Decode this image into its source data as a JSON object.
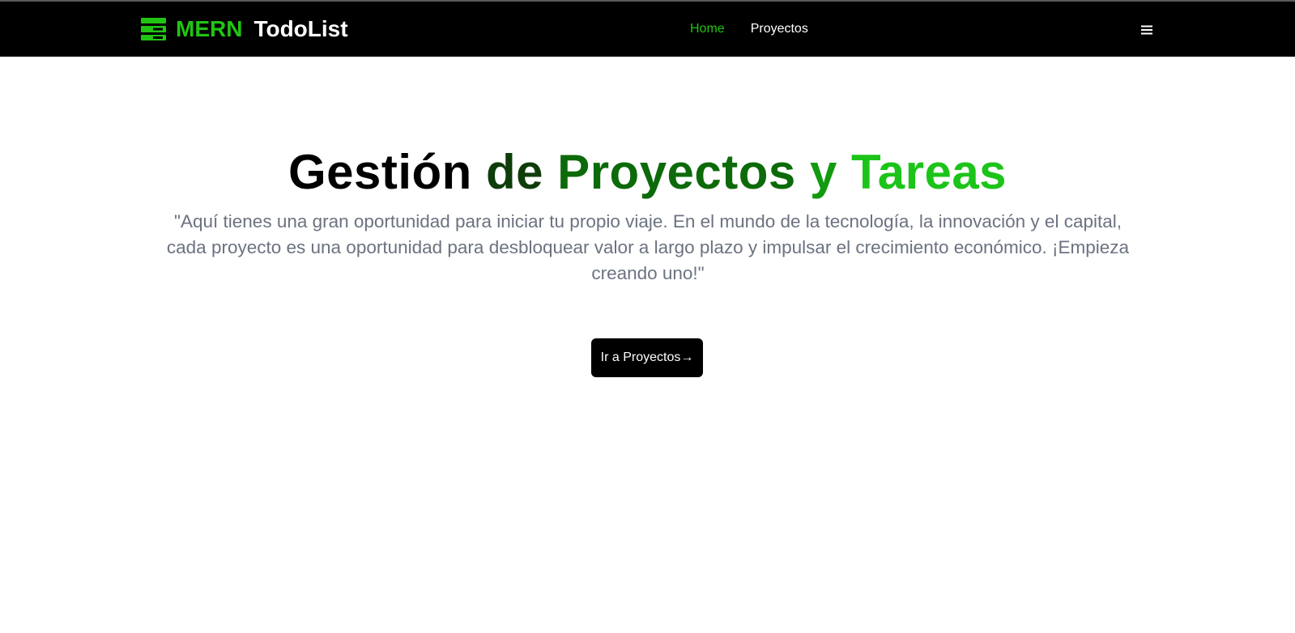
{
  "brand": {
    "prefix": "MERN",
    "name": "TodoList",
    "icon": "server-stack-icon",
    "accent_color": "#22c414"
  },
  "nav": {
    "items": [
      {
        "label": "Home",
        "active": true
      },
      {
        "label": "Proyectos",
        "active": false
      }
    ],
    "menu_icon": "hamburger-menu-icon"
  },
  "hero": {
    "title_parts": [
      "Gestión",
      "de",
      "Proyectos",
      "y",
      "Tareas"
    ],
    "description": "\"Aquí tienes una gran oportunidad para iniciar tu propio viaje. En el mundo de la tecnología, la innovación y el capital, cada proyecto es una oportunidad para desbloquear valor a largo plazo y impulsar el crecimiento económico. ¡Empieza creando uno!\"",
    "cta_label": "Ir a Proyectos",
    "cta_icon": "→"
  },
  "colors": {
    "navbar_bg": "#000000",
    "accent": "#22c414",
    "description_text": "#6b7280"
  }
}
